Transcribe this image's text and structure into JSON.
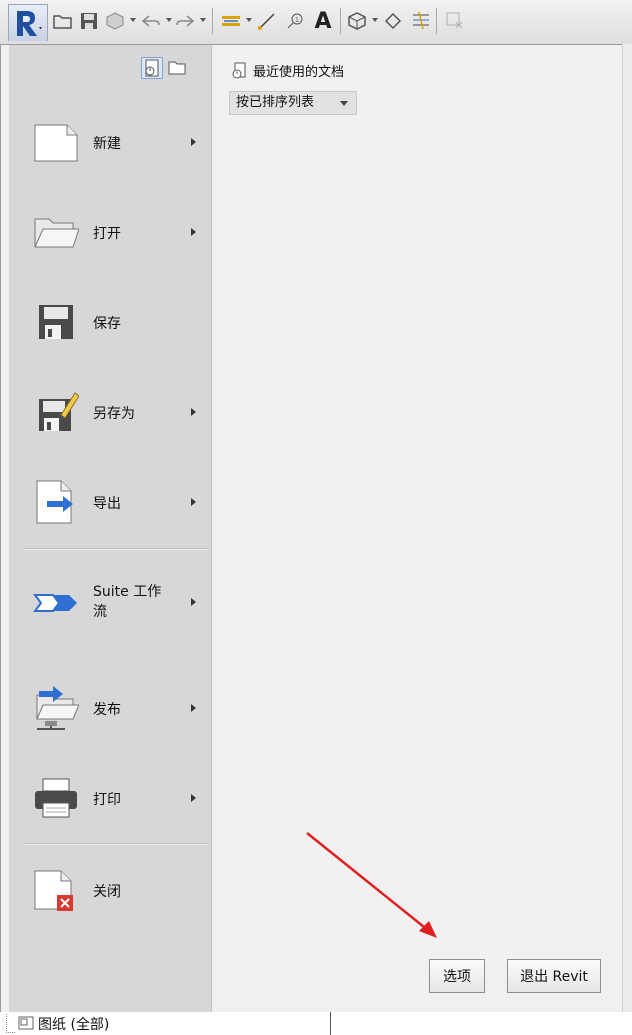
{
  "toolbar": {
    "icons": [
      "revit-app-icon",
      "open-folder-icon",
      "save-icon",
      "sync-icon",
      "undo-icon",
      "redo-icon",
      "measure-icon",
      "dimension-icon",
      "tag-icon",
      "text-icon",
      "3d-view-icon",
      "section-icon",
      "thin-lines-icon",
      "close-hidden-icon"
    ]
  },
  "left_menu": {
    "items": [
      {
        "label": "新建",
        "has_submenu": true
      },
      {
        "label": "打开",
        "has_submenu": true
      },
      {
        "label": "保存",
        "has_submenu": false
      },
      {
        "label": "另存为",
        "has_submenu": true
      },
      {
        "label": "导出",
        "has_submenu": true
      },
      {
        "label": "Suite 工作",
        "label2": "流",
        "has_submenu": true
      },
      {
        "label": "发布",
        "has_submenu": true
      },
      {
        "label": "打印",
        "has_submenu": true
      },
      {
        "label": "关闭",
        "has_submenu": false
      }
    ]
  },
  "recent": {
    "title": "最近使用的文档",
    "sort_label": "按已排序列表"
  },
  "buttons": {
    "options": "选项",
    "exit": "退出 Revit"
  },
  "project_browser": {
    "sheets_label": "图纸 (全部)"
  },
  "colors": {
    "accent": "#2f6fd1",
    "close_red": "#d9392f",
    "menu_bg": "#d7d7d7"
  }
}
